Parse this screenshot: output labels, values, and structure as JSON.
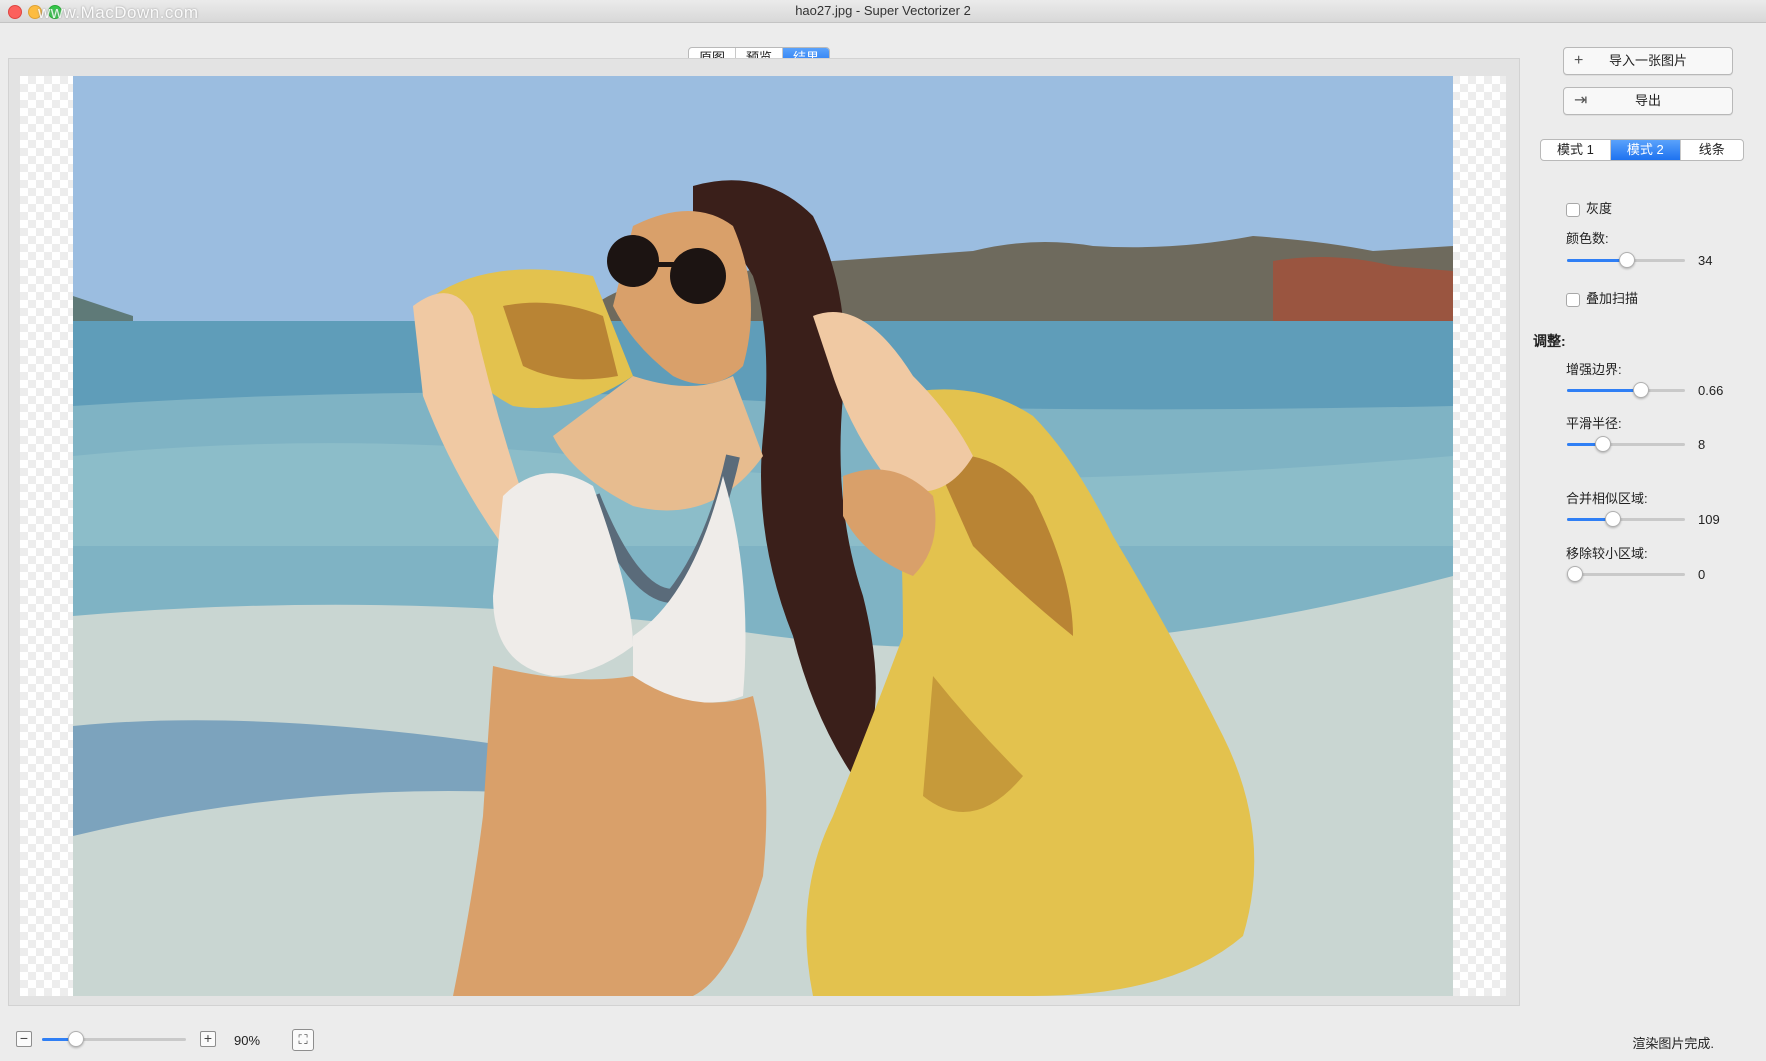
{
  "window": {
    "title": "hao27.jpg - Super Vectorizer 2",
    "watermark": "www.MacDown.com"
  },
  "view_tabs": [
    {
      "label": "原图",
      "active": false
    },
    {
      "label": "预览",
      "active": false
    },
    {
      "label": "结果",
      "active": true
    }
  ],
  "actions": {
    "import_label": "导入一张图片",
    "import_icon": "plus-icon",
    "export_label": "导出",
    "export_icon": "export-icon"
  },
  "mode_tabs": [
    {
      "label": "模式 1",
      "active": false
    },
    {
      "label": "模式 2",
      "active": true
    },
    {
      "label": "线条",
      "active": false
    }
  ],
  "options": {
    "grayscale": {
      "label": "灰度",
      "checked": false
    },
    "colors": {
      "label": "颜色数:",
      "value": "34",
      "fraction": 0.5
    },
    "overlay_scan": {
      "label": "叠加扫描",
      "checked": false
    }
  },
  "adjust": {
    "heading": "调整:",
    "enhance_edges": {
      "label": "增强边界:",
      "value": "0.66",
      "fraction": 0.63
    },
    "smooth_radius": {
      "label": "平滑半径:",
      "value": "8",
      "fraction": 0.27
    },
    "merge_similar": {
      "label": "合并相似区域:",
      "value": "109",
      "fraction": 0.37
    },
    "remove_small": {
      "label": "移除较小区域:",
      "value": "0",
      "fraction": 0.0
    }
  },
  "zoom": {
    "minus_icon": "minus-icon",
    "plus_icon": "plus-icon",
    "fit_icon": "fit-screen-icon",
    "value_label": "90%",
    "fraction": 0.2
  },
  "status": "渲染图片完成.",
  "colors": {
    "accent": "#2f7ff5",
    "sky": "#9bbde0",
    "sea": "#7fb3c4",
    "sand": "#c9d6d2",
    "yellow": "#e3c24e",
    "skin": "#d9a06a",
    "hair": "#3a1f1a"
  }
}
